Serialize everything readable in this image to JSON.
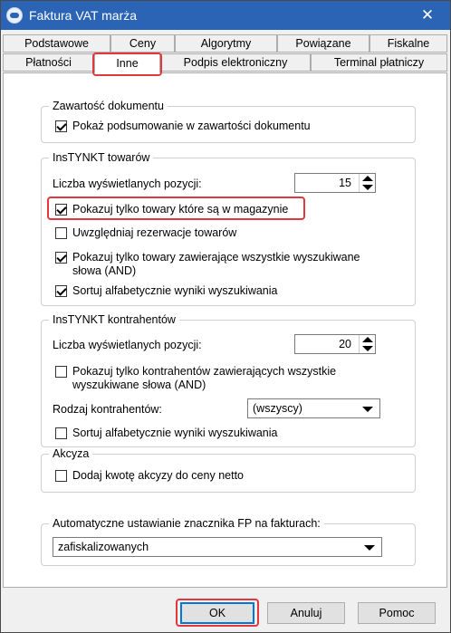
{
  "window": {
    "title": "Faktura VAT marża",
    "close_glyph": "✕",
    "accent_color": "#2b63b5",
    "highlight_color": "#e2383d"
  },
  "tabs": {
    "row1": [
      "Podstawowe",
      "Ceny",
      "Algorytmy",
      "Powiązane",
      "Fiskalne"
    ],
    "row2": [
      "Płatności",
      "Inne",
      "Podpis elektroniczny",
      "Terminal płatniczy"
    ],
    "active": "Inne"
  },
  "content": {
    "group1": {
      "title": "Zawartość dokumentu",
      "show_summary": {
        "label": "Pokaż podsumowanie w zawartości dokumentu",
        "checked": true
      }
    },
    "group2": {
      "title": "InsTYNKT towarów",
      "count_label": "Liczba wyświetlanych pozycji:",
      "count_value": "15",
      "only_in_stock": {
        "label": "Pokazuj tylko towary które są w magazynie",
        "checked": true
      },
      "reservations": {
        "label": "Uwzględniaj rezerwacje towarów",
        "checked": false
      },
      "all_words_line1": "Pokazuj tylko towary zawierające wszystkie wyszukiwane",
      "all_words_line2": "słowa (AND)",
      "all_words_checked": true,
      "sort_alpha": {
        "label": "Sortuj alfabetycznie wyniki wyszukiwania",
        "checked": true
      }
    },
    "group3": {
      "title": "InsTYNKT kontrahentów",
      "count_label": "Liczba wyświetlanych pozycji:",
      "count_value": "20",
      "all_words_line1": "Pokazuj tylko kontrahentów zawierających wszystkie",
      "all_words_line2": "wyszukiwane słowa (AND)",
      "all_words_checked": false,
      "type_label": "Rodzaj kontrahentów:",
      "type_value": "(wszyscy)",
      "sort_alpha": {
        "label": "Sortuj alfabetycznie wyniki wyszukiwania",
        "checked": false
      }
    },
    "group4": {
      "title": "Akcyza",
      "add_excise": {
        "label": "Dodaj kwotę akcyzy do ceny netto",
        "checked": false
      }
    },
    "group5": {
      "title": "Automatyczne ustawianie znacznika FP na fakturach:",
      "value": "zafiskalizowanych"
    }
  },
  "footer": {
    "ok": "OK",
    "cancel": "Anuluj",
    "help": "Pomoc"
  }
}
